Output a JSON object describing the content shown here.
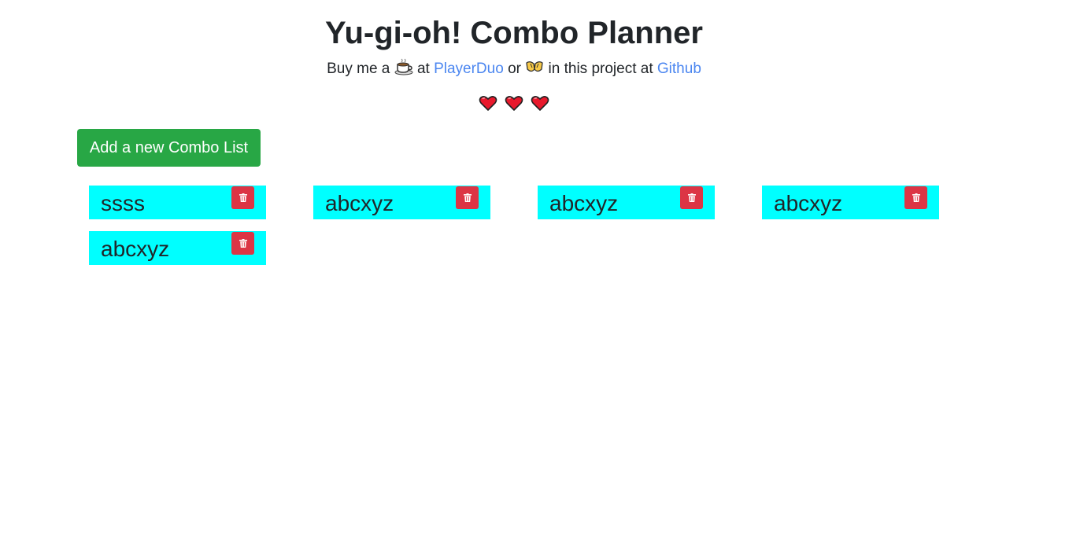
{
  "header": {
    "title": "Yu-gi-oh! Combo Planner",
    "subtitle": {
      "text_1": "Buy me a",
      "icon_1": "coffee-icon",
      "text_2": "at",
      "link_1": "PlayerDuo",
      "text_3": "or",
      "icon_2": "pray-hands-icon",
      "text_4": "in this project at",
      "link_2": "Github"
    },
    "hearts": [
      "heart-icon",
      "heart-icon",
      "heart-icon"
    ]
  },
  "actions": {
    "add_label": "Add a new Combo List"
  },
  "combo_lists": [
    {
      "name": "ssss"
    },
    {
      "name": "abcxyz"
    },
    {
      "name": "abcxyz"
    },
    {
      "name": "abcxyz"
    },
    {
      "name": "abcxyz"
    }
  ],
  "colors": {
    "card_background": "#00ffff",
    "add_button": "#28a745",
    "delete_button": "#dc3545",
    "link": "#4b86f0"
  }
}
